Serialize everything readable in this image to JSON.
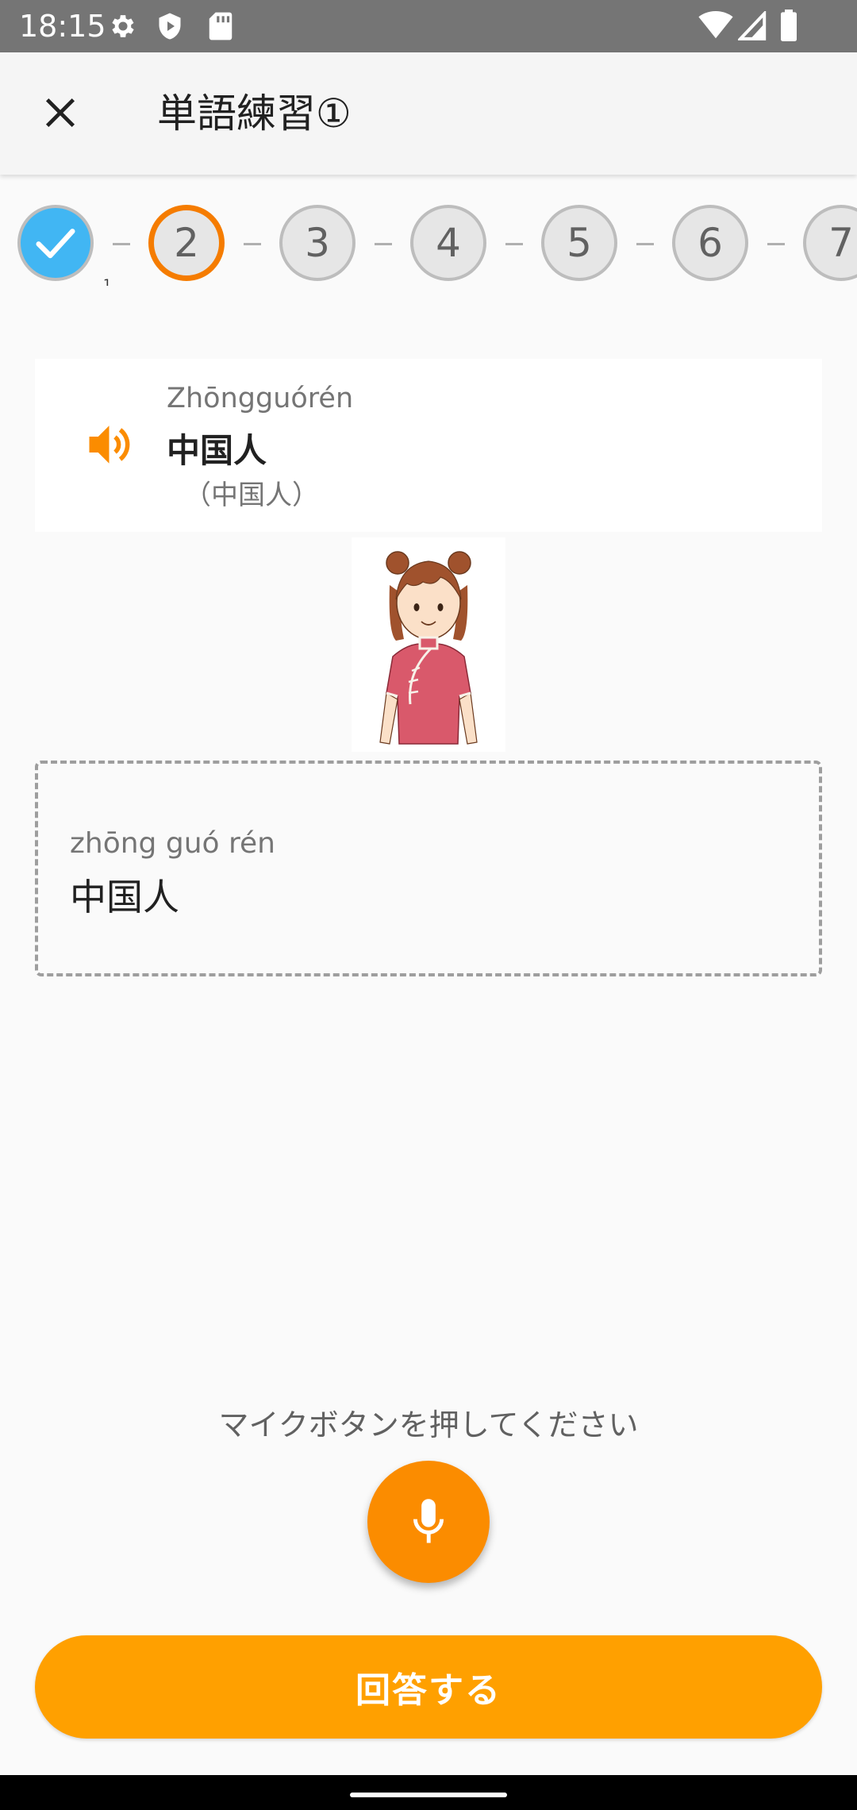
{
  "status_bar": {
    "time": "18:15",
    "icons": [
      "gear-icon",
      "shield-icon",
      "sd-card-icon",
      "wifi-icon",
      "signal-icon",
      "battery-icon"
    ]
  },
  "app_bar": {
    "title": "単語練習①",
    "close_icon": "close-icon"
  },
  "stepper": {
    "steps": [
      {
        "label": "",
        "state": "done",
        "sub": "1"
      },
      {
        "label": "2",
        "state": "current"
      },
      {
        "label": "3",
        "state": "pending"
      },
      {
        "label": "4",
        "state": "pending"
      },
      {
        "label": "5",
        "state": "pending"
      },
      {
        "label": "6",
        "state": "pending"
      },
      {
        "label": "7",
        "state": "pending"
      }
    ]
  },
  "word_card": {
    "pinyin": "Zhōngguórén",
    "hanzi": "中国人",
    "meaning": "中国人",
    "speaker_icon": "speaker-icon"
  },
  "answer": {
    "pinyin": "zhōng guó rén",
    "hanzi": "中国人"
  },
  "prompt": "マイクボタンを押してください",
  "mic_icon": "microphone-icon",
  "submit_label": "回答する",
  "colors": {
    "accent_orange": "#f57c00",
    "button_orange": "#ffa000",
    "mic_orange": "#fb8c00",
    "done_blue": "#41b6f3",
    "status_bar": "#757575"
  }
}
